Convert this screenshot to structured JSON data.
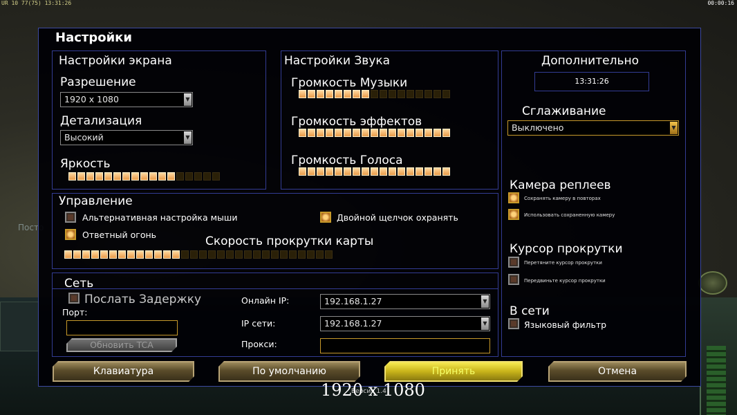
{
  "hud": {
    "left": "UR 10 77(75) 13:31:26",
    "right": "00:00:16"
  },
  "background": {
    "ghost_text": "Посто"
  },
  "dialog": {
    "title": "Настройки"
  },
  "screen": {
    "title": "Настройки экрана",
    "resolution_label": "Разрешение",
    "resolution_value": "1920 x 1080",
    "detail_label": "Детализация",
    "detail_value": "Высокий",
    "brightness_label": "Яркость",
    "brightness": {
      "filled": 12,
      "total": 17
    }
  },
  "sound": {
    "title": "Настройки Звука",
    "music_label": "Громкость Музыки",
    "music": {
      "filled": 8,
      "total": 17
    },
    "effects_label": "Громкость эффектов",
    "effects": {
      "filled": 17,
      "total": 17
    },
    "voice_label": "Громкость Голоса",
    "voice": {
      "filled": 17,
      "total": 17
    }
  },
  "extra": {
    "title": "Дополнительно",
    "clock": "13:31:26",
    "antialias_label": "Сглаживание",
    "antialias_value": "Выключено",
    "replay_camera_title": "Камера реплеев",
    "replay_save_camera": "Сохранять камеру в повторах",
    "replay_use_saved": "Использовать сохраненную камеру",
    "scroll_cursor_title": "Курсор прокрутки",
    "scroll_cursor_drag": "Перетяните курсор прокрутки",
    "scroll_cursor_move": "Передвиньте курсор прокрутки",
    "online_title": "В сети",
    "language_filter": "Языковый фильтр"
  },
  "control": {
    "title": "Управление",
    "alt_mouse": "Альтернативная настройка мыши",
    "double_click_guard": "Двойной щелчок охранять",
    "return_fire": "Ответный огонь",
    "scroll_speed_label": "Скорость прокрутки карты",
    "scroll_speed": {
      "filled": 13,
      "total": 30
    }
  },
  "network": {
    "title": "Сеть",
    "send_delay": "Послать Задержку",
    "port_label": "Порт:",
    "update_tca": "Обновить TCA",
    "online_ip_label": "Онлайн IP:",
    "online_ip_value": "192.168.1.27",
    "lan_ip_label": "IP сети:",
    "lan_ip_value": "192.168.1.27",
    "proxy_label": "Прокси:"
  },
  "buttons": {
    "keyboard": "Клавиатура",
    "defaults": "По умолчанию",
    "accept": "Принять",
    "cancel": "Отмена"
  },
  "footer": {
    "caption": "1920 x 1080",
    "version": "Версия 1.4"
  },
  "checks": {
    "alt_mouse": false,
    "double_click_guard": true,
    "return_fire": true,
    "send_delay": false,
    "replay_save_camera": true,
    "replay_use_saved": true,
    "scroll_cursor_drag": false,
    "scroll_cursor_move": false,
    "language_filter": false
  },
  "colors": {
    "accent": "#c89a2a",
    "border": "#333c94",
    "slider_on": "#f0b070",
    "accept": "#e8d83a"
  }
}
